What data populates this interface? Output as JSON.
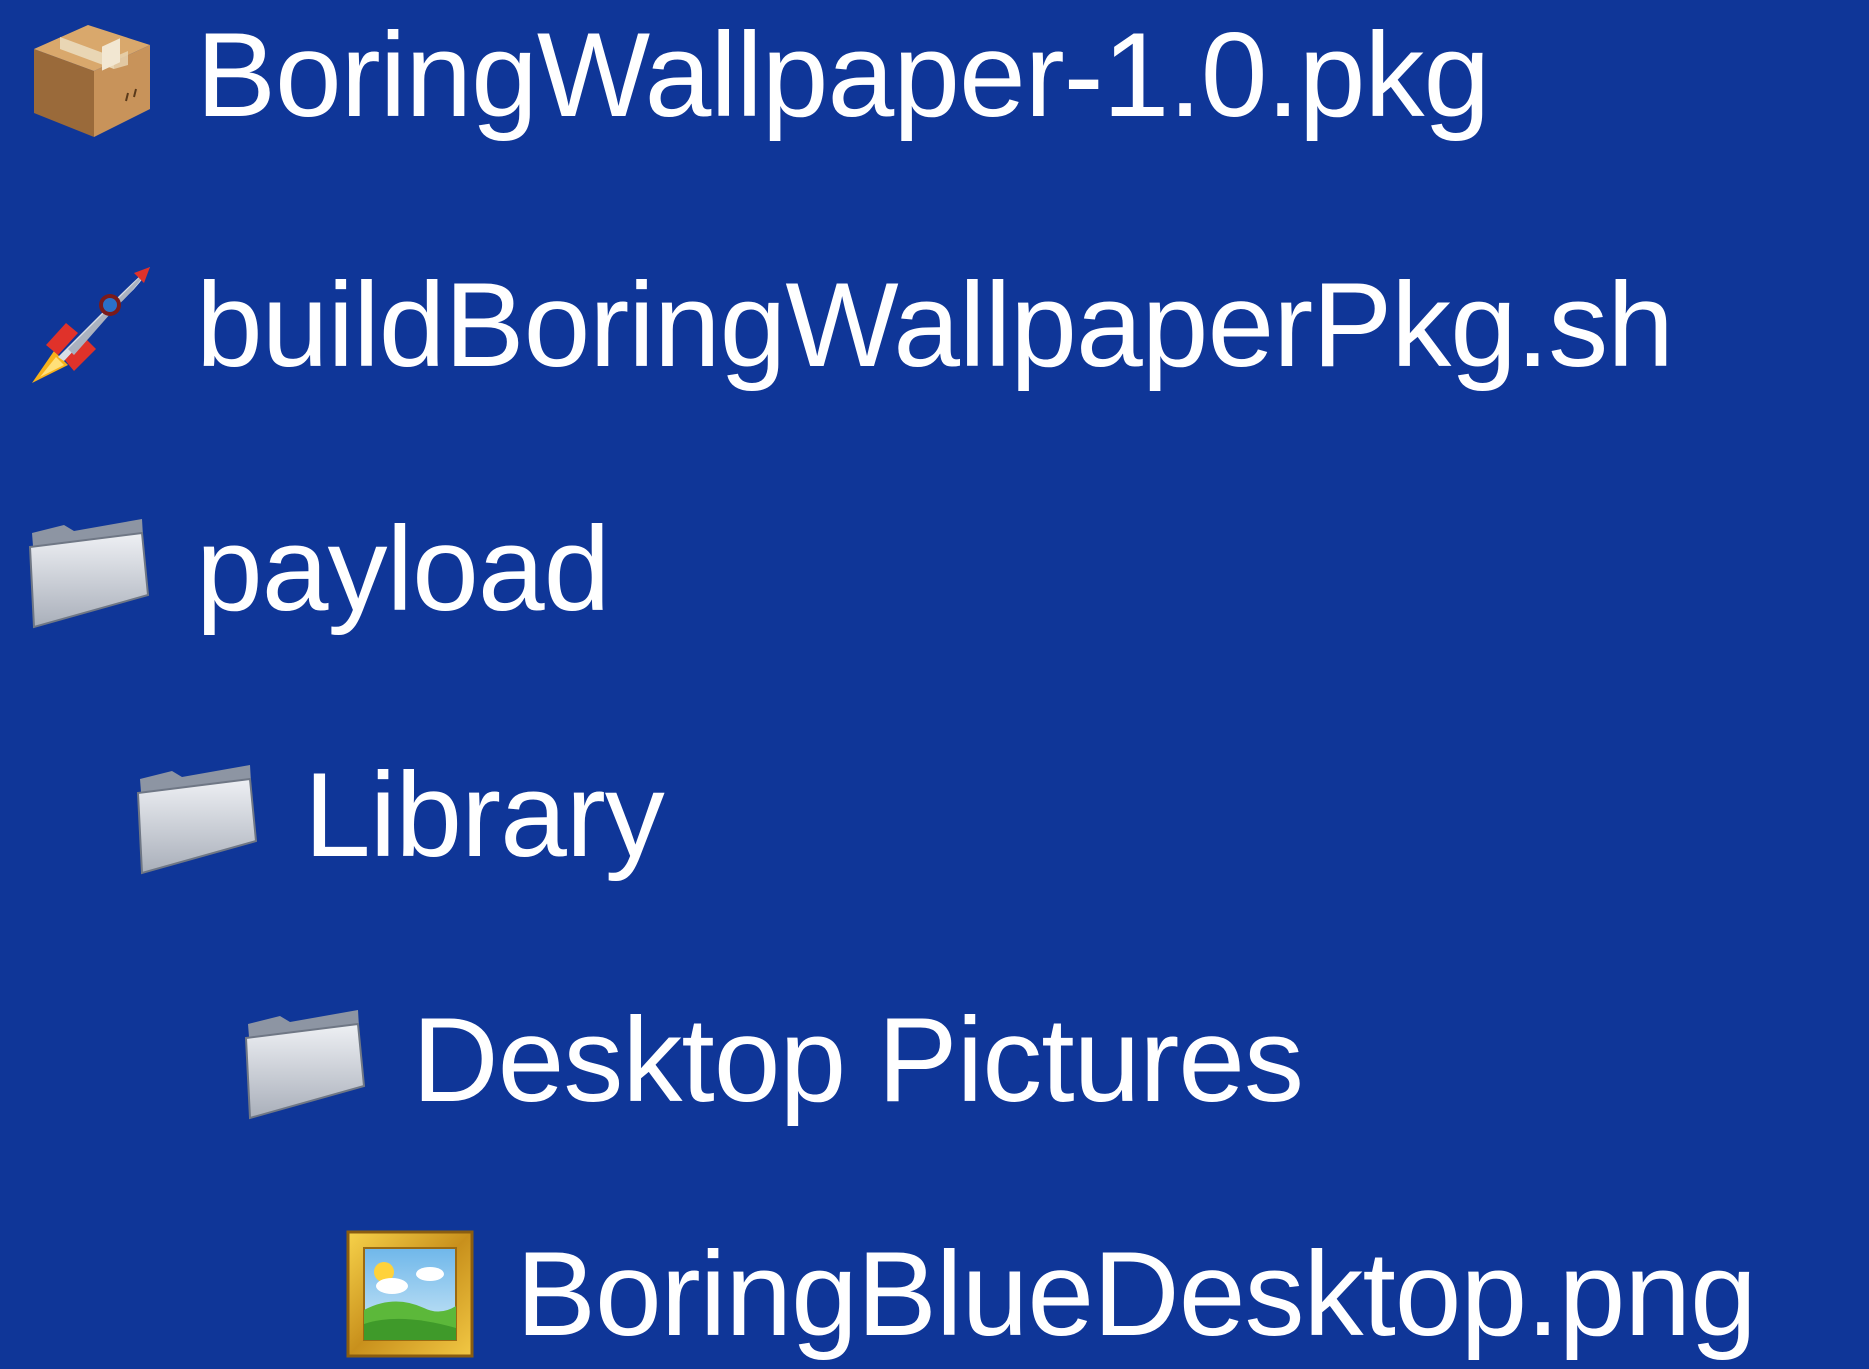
{
  "background_color": "#0f3698",
  "text_color": "#ffffff",
  "items": [
    {
      "label": "BoringWallpaper-1.0.pkg",
      "icon": "package-icon",
      "depth": 0
    },
    {
      "label": "buildBoringWallpaperPkg.sh",
      "icon": "rocket-icon",
      "depth": 0
    },
    {
      "label": "payload",
      "icon": "folder-icon",
      "depth": 0
    },
    {
      "label": "Library",
      "icon": "folder-icon",
      "depth": 1
    },
    {
      "label": "Desktop Pictures",
      "icon": "folder-icon",
      "depth": 2
    },
    {
      "label": "BoringBlueDesktop.png",
      "icon": "framed-picture-icon",
      "depth": 3
    }
  ]
}
